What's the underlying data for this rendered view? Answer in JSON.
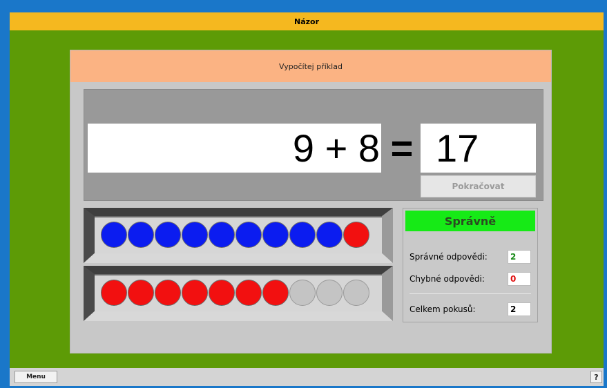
{
  "window": {
    "title": "Názor"
  },
  "task": {
    "instruction": "Vypočítej příklad",
    "expression": "9 + 8",
    "equals_sign": "=",
    "answer": "17",
    "continue_label": "Pokračovat"
  },
  "abacus": {
    "rows": [
      {
        "beads": [
          "blue",
          "blue",
          "blue",
          "blue",
          "blue",
          "blue",
          "blue",
          "blue",
          "blue",
          "red"
        ]
      },
      {
        "beads": [
          "red",
          "red",
          "red",
          "red",
          "red",
          "red",
          "red",
          "gray",
          "gray",
          "gray"
        ]
      }
    ],
    "colors": {
      "blue": "#0b1cf0",
      "red": "#f21010",
      "gray": "#c4c4c4"
    }
  },
  "result": {
    "status": "Správně",
    "status_color": "#16ea16",
    "correct_label": "Správné odpovědi:",
    "correct_value": "2",
    "correct_color": "#1a8a1a",
    "wrong_label": "Chybné odpovědi:",
    "wrong_value": "0",
    "wrong_color": "#e01010",
    "total_label": "Celkem pokusů:",
    "total_value": "2"
  },
  "footer": {
    "menu_label": "Menu",
    "help_label": "?"
  },
  "colors": {
    "frame": "#1a77c9",
    "title_bar": "#f5b81f",
    "background": "#5d9b06",
    "header": "#fbb383"
  }
}
